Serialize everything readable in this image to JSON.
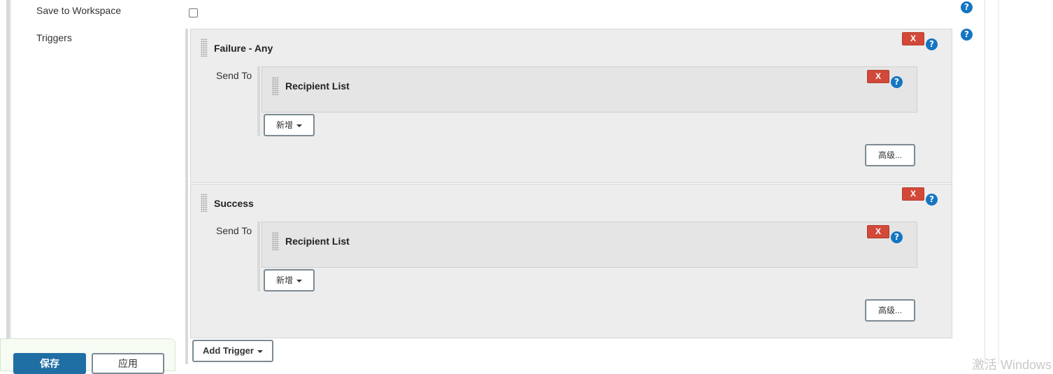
{
  "form": {
    "save_to_workspace_label": "Save to Workspace",
    "save_to_workspace_checked": false,
    "triggers_label": "Triggers"
  },
  "triggers": [
    {
      "title": "Failure - Any",
      "send_to_label": "Send To",
      "recipient_title": "Recipient List",
      "add_label": "新增",
      "advanced_label": "高级...",
      "delete_label": "X"
    },
    {
      "title": "Success",
      "send_to_label": "Send To",
      "recipient_title": "Recipient List",
      "add_label": "新增",
      "advanced_label": "高级...",
      "delete_label": "X"
    }
  ],
  "add_trigger_label": "Add Trigger",
  "help_icon_glyph": "?",
  "footer": {
    "save_label": "保存",
    "apply_label": "应用"
  },
  "watermark": "激活 Windows",
  "colors": {
    "accent": "#1576c2",
    "danger": "#d24939",
    "primary_button": "#1f6ea4"
  }
}
